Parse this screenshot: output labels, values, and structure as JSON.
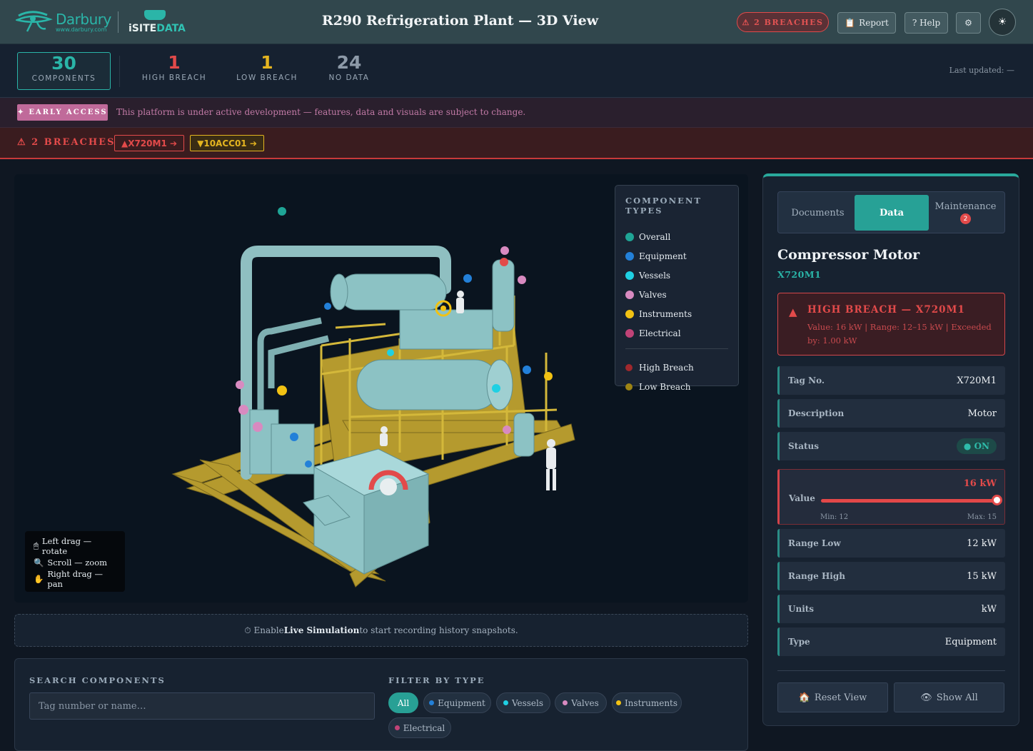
{
  "header": {
    "logo_name": "Darbury",
    "logo_url": "www.darbury.com",
    "logo2_a": "iSITE",
    "logo2_b": "DATA",
    "title": "R290 Refrigeration Plant — 3D View",
    "breach_pill": "⚠ 2 BREACHES",
    "report_label": "Report",
    "help_label": "? Help",
    "settings_icon": "gear-icon",
    "theme_icon": "sun-icon"
  },
  "stats": [
    {
      "value": "30",
      "label": "COMPONENTS",
      "color": "#2ab5a8"
    },
    {
      "value": "1",
      "label": "HIGH BREACH",
      "color": "#e24a4a"
    },
    {
      "value": "1",
      "label": "LOW BREACH",
      "color": "#e5b520"
    },
    {
      "value": "24",
      "label": "NO DATA",
      "color": "#8d9aa8"
    }
  ],
  "last_updated": "Last updated: —",
  "early_access": {
    "badge": "✦ EARLY ACCESS",
    "text": "This platform is under active development — features, data and visuals are subject to change."
  },
  "breach_bar": {
    "title": "⚠ 2 BREACHES",
    "chips": [
      {
        "label": "▲X720M1 ➔",
        "color": "#e24a4a"
      },
      {
        "label": "▼10ACC01 ➔",
        "color": "#e5b520"
      }
    ]
  },
  "legend": {
    "title": "COMPONENT TYPES",
    "types": [
      {
        "label": "Overall",
        "color": "#1fa596"
      },
      {
        "label": "Equipment",
        "color": "#2380d8"
      },
      {
        "label": "Vessels",
        "color": "#1fd0e3"
      },
      {
        "label": "Valves",
        "color": "#d88ac0"
      },
      {
        "label": "Instruments",
        "color": "#f2c213"
      },
      {
        "label": "Electrical",
        "color": "#c04377"
      }
    ],
    "status": [
      {
        "label": "High Breach",
        "color": "#a0282d"
      },
      {
        "label": "Low Breach",
        "color": "#9e8414"
      }
    ]
  },
  "controls_help": [
    "Left drag — rotate",
    "Scroll — zoom",
    "Right drag — pan"
  ],
  "history_text_a": "⏱ Enable ",
  "history_text_b": "Live Simulation",
  "history_text_c": " to start recording history snapshots.",
  "search": {
    "title": "SEARCH COMPONENTS",
    "placeholder": "Tag number or name…",
    "filter_title": "FILTER BY TYPE",
    "filters": [
      {
        "label": "All",
        "active": true
      },
      {
        "label": "Equipment",
        "color": "#2380d8"
      },
      {
        "label": "Vessels",
        "color": "#1fd0e3"
      },
      {
        "label": "Valves",
        "color": "#d88ac0"
      },
      {
        "label": "Instruments",
        "color": "#f2c213"
      },
      {
        "label": "Electrical",
        "color": "#c04377"
      }
    ]
  },
  "panel": {
    "tabs": [
      "Documents",
      "Data",
      "Maintenance"
    ],
    "maintenance_badge": "2",
    "title": "Compressor Motor",
    "tag": "X720M1",
    "alert_title": "HIGH BREACH — X720M1",
    "alert_body": "Value: 16 kW | Range: 12–15 kW | Exceeded by: 1.00 kW",
    "rows_top": [
      {
        "k": "Tag No.",
        "v": "X720M1"
      },
      {
        "k": "Description",
        "v": "Motor"
      }
    ],
    "status_key": "Status",
    "status_val": "● ON",
    "value_key": "Value",
    "value_val": "16 kW",
    "value_fraction": 1.0,
    "value_min": "Min: 12",
    "value_max": "Max: 15",
    "rows_bottom": [
      {
        "k": "Range Low",
        "v": "12 kW"
      },
      {
        "k": "Range High",
        "v": "15 kW"
      },
      {
        "k": "Units",
        "v": "kW"
      },
      {
        "k": "Type",
        "v": "Equipment"
      }
    ],
    "reset_label": "Reset View",
    "showall_label": "Show All"
  }
}
